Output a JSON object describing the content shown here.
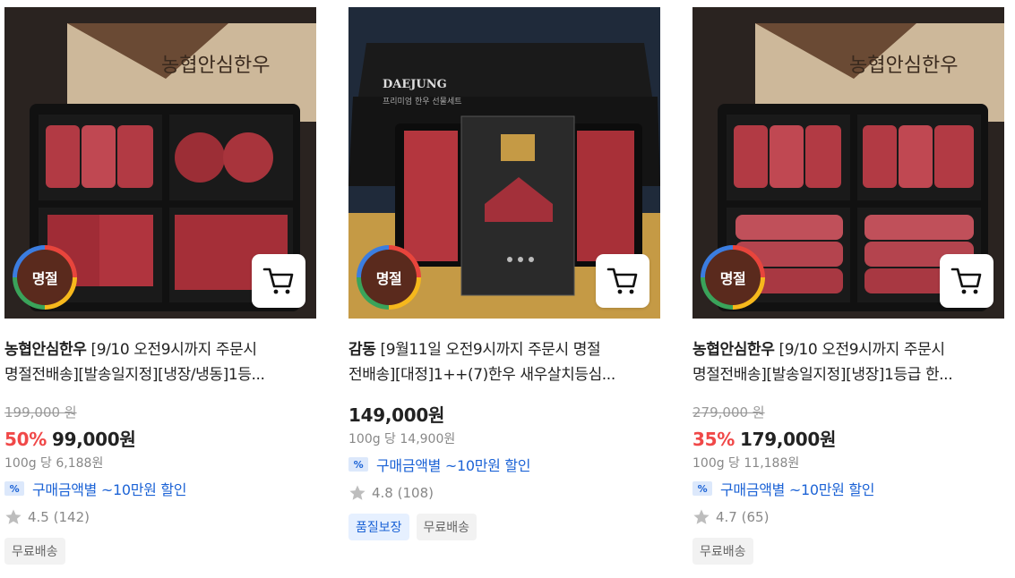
{
  "products": [
    {
      "badge": "명절",
      "brand": "농협안심한우",
      "title_line1": " [9/10 오전9시까지 주문시",
      "title_line2": "명절전배송][발송일지정][냉장/냉동]1등...",
      "original_price": "199,000 원",
      "discount_rate": "50%",
      "price": "99,000원",
      "unit_price": "100g 당 6,188원",
      "coupon": "구매금액별 ~10만원 할인",
      "rating": "4.5",
      "review_count": "(142)",
      "tags": [
        "무료배송"
      ],
      "box_text": "농협안심한우"
    },
    {
      "badge": "명절",
      "brand": "감동",
      "title_line1": " [9월11일 오전9시까지 주문시 명절",
      "title_line2": "전배송][대정]1++(7)한우 새우살치등심...",
      "original_price": "",
      "discount_rate": "",
      "price": "149,000원",
      "unit_price": "100g 당 14,900원",
      "coupon": "구매금액별 ~10만원 할인",
      "rating": "4.8",
      "review_count": "(108)",
      "tags": [
        "품질보장",
        "무료배송"
      ],
      "box_text": "DAEJUNG",
      "box_sub": "프리미엄 한우 선물세트"
    },
    {
      "badge": "명절",
      "brand": "농협안심한우",
      "title_line1": " [9/10 오전9시까지 주문시",
      "title_line2": "명절전배송][발송일지정][냉장]1등급 한...",
      "original_price": "279,000 원",
      "discount_rate": "35%",
      "price": "179,000원",
      "unit_price": "100g 당 11,188원",
      "coupon": "구매금액별 ~10만원 할인",
      "rating": "4.7",
      "review_count": "(65)",
      "tags": [
        "무료배송"
      ],
      "box_text": "농협안심한우"
    }
  ],
  "colors": {
    "discount": "#f04848",
    "coupon": "#1c63d6",
    "badge": "#5a2a1d"
  },
  "icons": {
    "cart": "cart-icon",
    "star": "star-icon",
    "coupon": "coupon-icon"
  }
}
